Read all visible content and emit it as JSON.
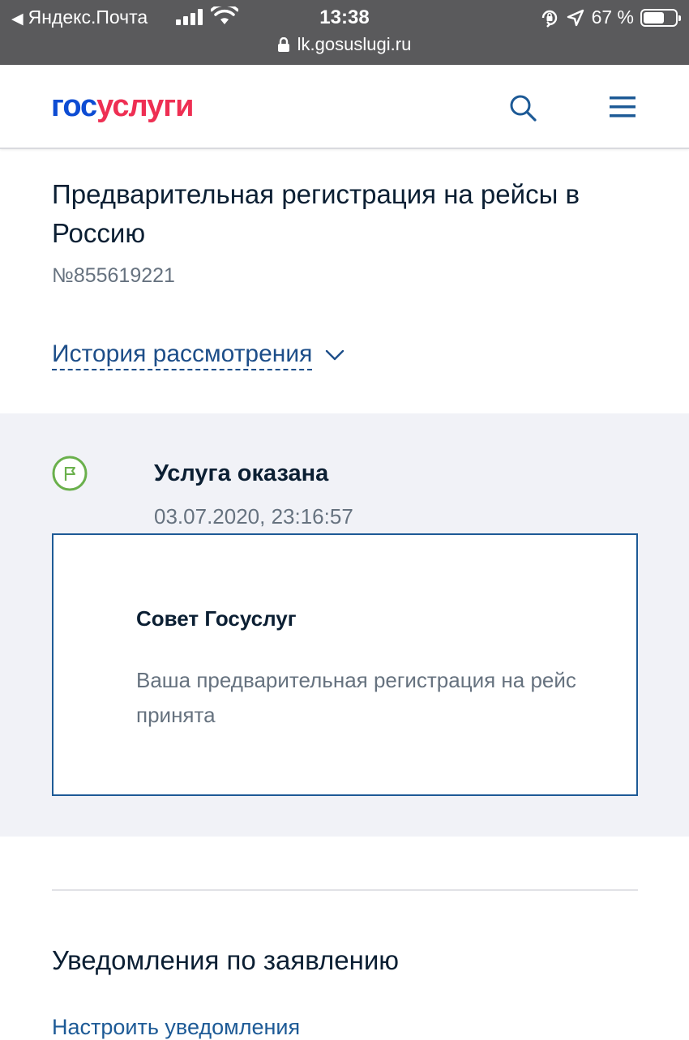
{
  "statusbar": {
    "back_app": "Яндекс.Почта",
    "time": "13:38",
    "battery_text": "67 %",
    "battery_level": 0.67,
    "url": "lk.gosuslugi.ru"
  },
  "header": {
    "logo_part1": "гос",
    "logo_part2": "услуги",
    "icons": [
      "search-icon",
      "menu-icon"
    ]
  },
  "application": {
    "title": "Предварительная регистрация на рейсы в Россию",
    "number": "№855619221",
    "history_label": "История рассмотрения"
  },
  "status": {
    "title": "Услуга оказана",
    "datetime": "03.07.2020, 23:16:57",
    "advice_title": "Совет Госуслуг",
    "advice_text": "Ваша предварительная регистрация на рейс принята"
  },
  "notifications": {
    "title": "Уведомления по заявлению",
    "link": "Настроить уведомления"
  },
  "colors": {
    "brand_blue": "#0d4cd3",
    "brand_red": "#ee2f53",
    "success_green": "#6ab04c",
    "link_blue": "#1d5a96"
  }
}
